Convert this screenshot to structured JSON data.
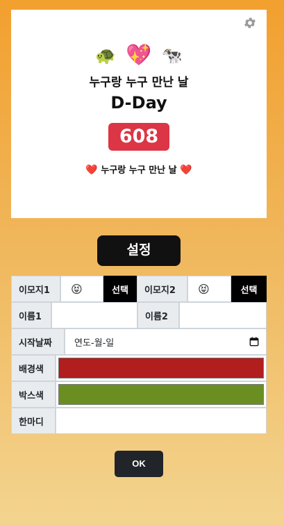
{
  "preview": {
    "emoji1": "🐢",
    "heart": "💖",
    "emoji2": "🐄",
    "names_title": "누구랑 누구 만난 날",
    "dday_label": "D-Day",
    "count": "608",
    "message_heart": "❤️",
    "message": "누구랑 누구 만난 날"
  },
  "settings_button": "설정",
  "form": {
    "emoji1_label": "이모지1",
    "emoji1_value": "😝",
    "emoji1_pick": "선택",
    "emoji2_label": "이모지2",
    "emoji2_value": "😝",
    "emoji2_pick": "선택",
    "name1_label": "이름1",
    "name1_value": "",
    "name2_label": "이름2",
    "name2_value": "",
    "start_date_label": "시작날짜",
    "start_date_placeholder": "연도-월-일",
    "bg_color_label": "배경색",
    "bg_color": "#b01e1e",
    "box_color_label": "박스색",
    "box_color": "#6b8e23",
    "memo_label": "한마디",
    "memo_value": ""
  },
  "ok_button": "OK",
  "icons": {
    "settings": "gear-icon",
    "calendar": "calendar-icon"
  }
}
